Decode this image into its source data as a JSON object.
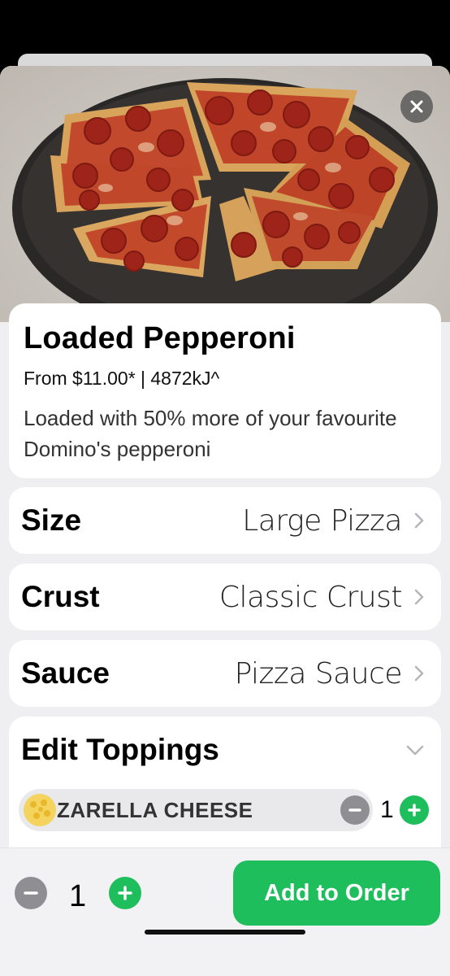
{
  "product": {
    "name": "Loaded Pepperoni",
    "price_energy": "From $11.00* | 4872kJ^",
    "description": "Loaded with 50% more of your favourite Domino's pepperoni"
  },
  "options": [
    {
      "label": "Size",
      "value": "Large Pizza"
    },
    {
      "label": "Crust",
      "value": "Classic Crust"
    },
    {
      "label": "Sauce",
      "value": "Pizza Sauce"
    }
  ],
  "toppings": {
    "header": "Edit Toppings",
    "items": [
      {
        "name": "MOZZARELLA CHEESE",
        "visible_name": "ZARELLA CHEESE",
        "qty": "1"
      }
    ]
  },
  "order": {
    "qty": "1",
    "add_label": "Add to Order"
  },
  "colors": {
    "accent_green": "#1fbe5d",
    "stepper_grey": "#8e8e93"
  }
}
